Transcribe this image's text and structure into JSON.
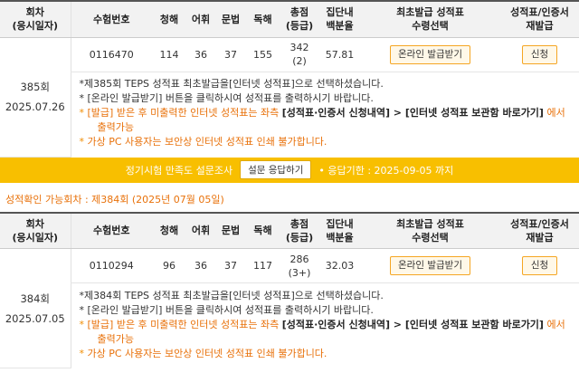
{
  "headers": {
    "round": "회차\n(응시일자)",
    "exam_no": "수험번호",
    "listening": "청해",
    "vocab": "어휘",
    "grammar": "문법",
    "reading": "독해",
    "total": "총점\n(등급)",
    "percentile": "집단내\n백분율",
    "issue_type": "최초발급 성적표\n수령선택",
    "reissue": "성적표/인증서\n재발급"
  },
  "records": [
    {
      "round": "385회",
      "date": "2025.07.26",
      "exam_no": "0116470",
      "listening": "114",
      "vocab": "36",
      "grammar": "37",
      "reading": "155",
      "total": "342",
      "grade": "(2)",
      "percentile": "57.81",
      "issue_button": "온라인 발급받기",
      "reissue_button": "신청",
      "notes": [
        {
          "a": "*제385회 TEPS 성적표 최초발급을[인터넷 성적표]으로 선택하셨습니다."
        },
        {
          "a": "* [온라인 발급받기] 버튼을 클릭하시여 성적표를 출력하시기 바랍니다."
        },
        {
          "a": "[발급] 받은 후 미출력한 인터넷 성적표는 좌측 ",
          "b": "[성적표·인증서 신청내역] > [인터넷 성적표 보관함 바로가기]",
          "c": " 에서",
          "d": "출력가능"
        },
        {
          "a": "가상 PC 사용자는 보안상 인터넷 성적표 인쇄 불가합니다."
        }
      ]
    },
    {
      "round": "384회",
      "date": "2025.07.05",
      "exam_no": "0110294",
      "listening": "96",
      "vocab": "36",
      "grammar": "37",
      "reading": "117",
      "total": "286",
      "grade": "(3+)",
      "percentile": "32.03",
      "issue_button": "온라인 발급받기",
      "reissue_button": "신청",
      "notes": [
        {
          "a": "*제384회 TEPS 성적표 최초발급을[인터넷 성적표]으로 선택하셨습니다."
        },
        {
          "a": "* [온라인 발급받기] 버튼을 클릭하시여 성적표를 출력하시기 바랍니다."
        },
        {
          "a": "[발급] 받은 후 미출력한 인터넷 성적표는 좌측 ",
          "b": "[성적표·인증서 신청내역] > [인터넷 성적표 보관함 바로가기]",
          "c": " 에서",
          "d": "출력가능"
        },
        {
          "a": "가상 PC 사용자는 보안상 인터넷 성적표 인쇄 불가합니다."
        }
      ]
    }
  ],
  "survey": {
    "text": "정기시험 만족도 설문조사",
    "button": "설문 응답하기",
    "deadline": "• 응답기한 : 2025-09-05 까지"
  },
  "confirm_label": "성적확인 가능회차 : 제384회 (2025년 07월 05일)",
  "colors": {
    "accent": "#f8bf00",
    "orange_text": "#e8710a"
  }
}
